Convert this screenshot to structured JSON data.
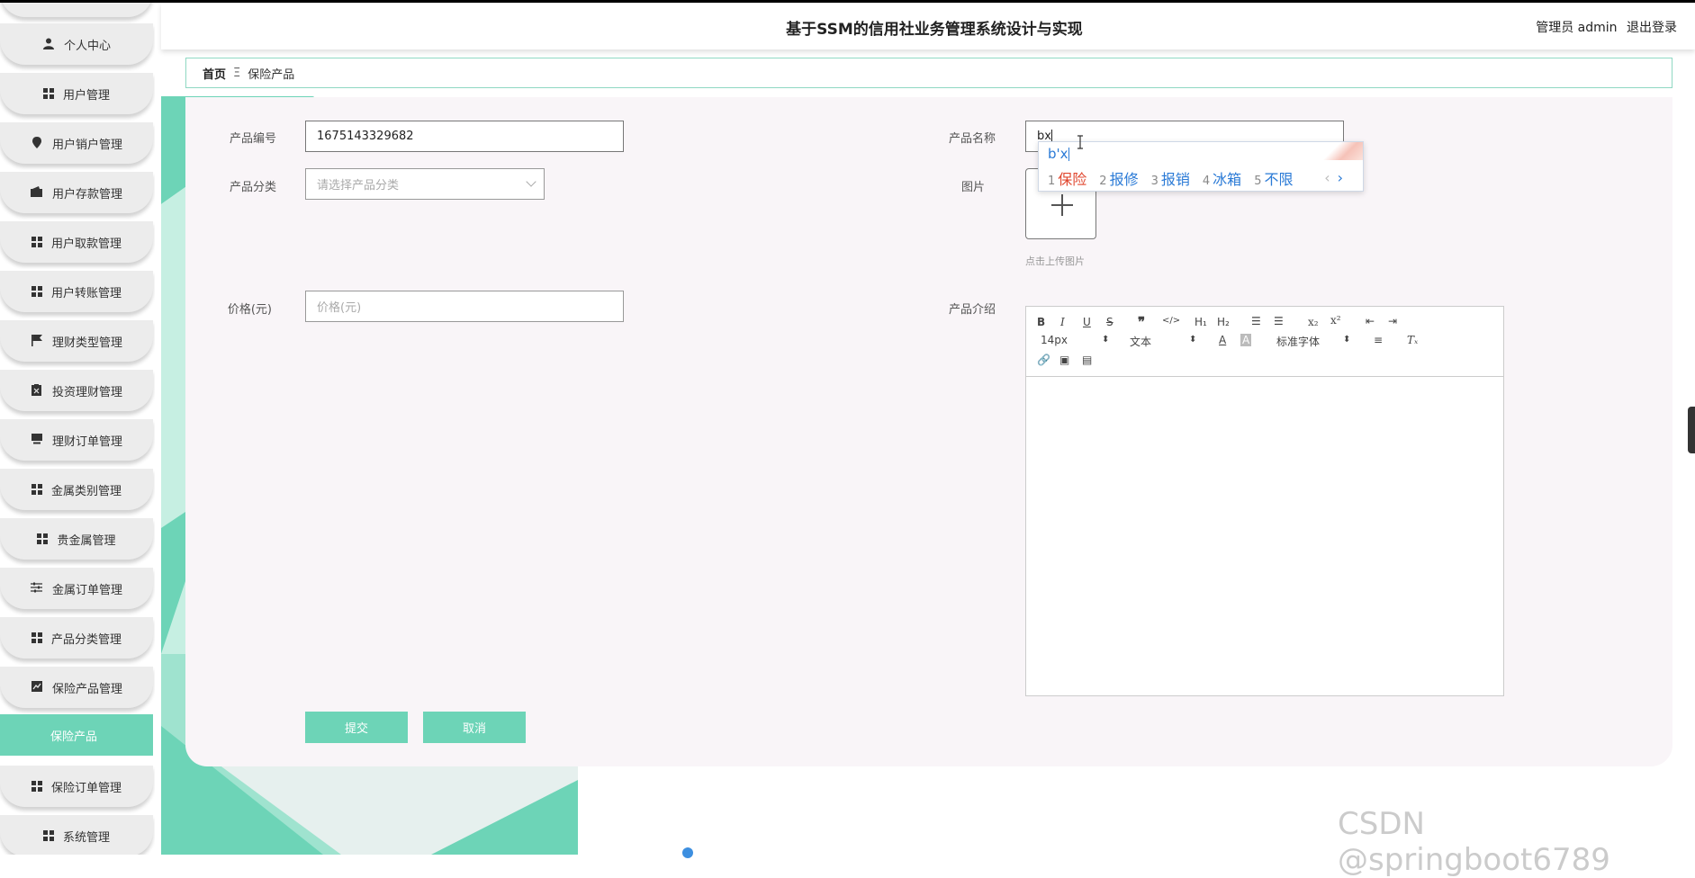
{
  "header": {
    "title": "基于SSM的信用社业务管理系统设计与实现",
    "user_role": "管理员 admin",
    "logout": "退出登录"
  },
  "sidebar": {
    "items": [
      {
        "label": "个人中心",
        "icon": "person-icon"
      },
      {
        "label": "用户管理",
        "icon": "grid-icon"
      },
      {
        "label": "用户销户管理",
        "icon": "pin-icon"
      },
      {
        "label": "用户存款管理",
        "icon": "wallet-icon"
      },
      {
        "label": "用户取款管理",
        "icon": "grid-icon"
      },
      {
        "label": "用户转账管理",
        "icon": "grid-icon"
      },
      {
        "label": "理财类型管理",
        "icon": "flag-icon"
      },
      {
        "label": "投资理财管理",
        "icon": "clipboard-icon"
      },
      {
        "label": "理财订单管理",
        "icon": "monitor-icon"
      },
      {
        "label": "金属类别管理",
        "icon": "grid-icon"
      },
      {
        "label": "贵金属管理",
        "icon": "grid-icon"
      },
      {
        "label": "金属订单管理",
        "icon": "sliders-icon"
      },
      {
        "label": "产品分类管理",
        "icon": "grid-icon"
      },
      {
        "label": "保险产品管理",
        "icon": "chart-icon"
      },
      {
        "label": "保险产品",
        "icon": ""
      },
      {
        "label": "保险订单管理",
        "icon": "grid-icon"
      },
      {
        "label": "系统管理",
        "icon": "grid-icon"
      }
    ],
    "active_index": 14
  },
  "breadcrumb": {
    "home": "首页",
    "separator": "Ξ",
    "current": "保险产品"
  },
  "form": {
    "product_no_label": "产品编号",
    "product_no_value": "1675143329682",
    "product_name_label": "产品名称",
    "product_name_value": "bx",
    "category_label": "产品分类",
    "category_placeholder": "请选择产品分类",
    "image_label": "图片",
    "upload_tip": "点击上传图片",
    "price_label": "价格(元)",
    "price_placeholder": "价格(元)",
    "intro_label": "产品介绍",
    "submit": "提交",
    "cancel": "取消"
  },
  "editor": {
    "font_size": "14px",
    "paragraph": "文本",
    "font_family": "标准字体"
  },
  "ime": {
    "composition": "b'x",
    "candidates": [
      {
        "num": "1",
        "text": "保险"
      },
      {
        "num": "2",
        "text": "报修"
      },
      {
        "num": "3",
        "text": "报销"
      },
      {
        "num": "4",
        "text": "冰箱"
      },
      {
        "num": "5",
        "text": "不限"
      }
    ],
    "prev": "‹",
    "next": "›"
  },
  "watermark": "CSDN @springboot6789",
  "colors": {
    "accent": "#6dd4b7",
    "panel_bg": "#f9f5f8",
    "ime_blue": "#2a7ad6",
    "ime_red": "#e0462e"
  }
}
